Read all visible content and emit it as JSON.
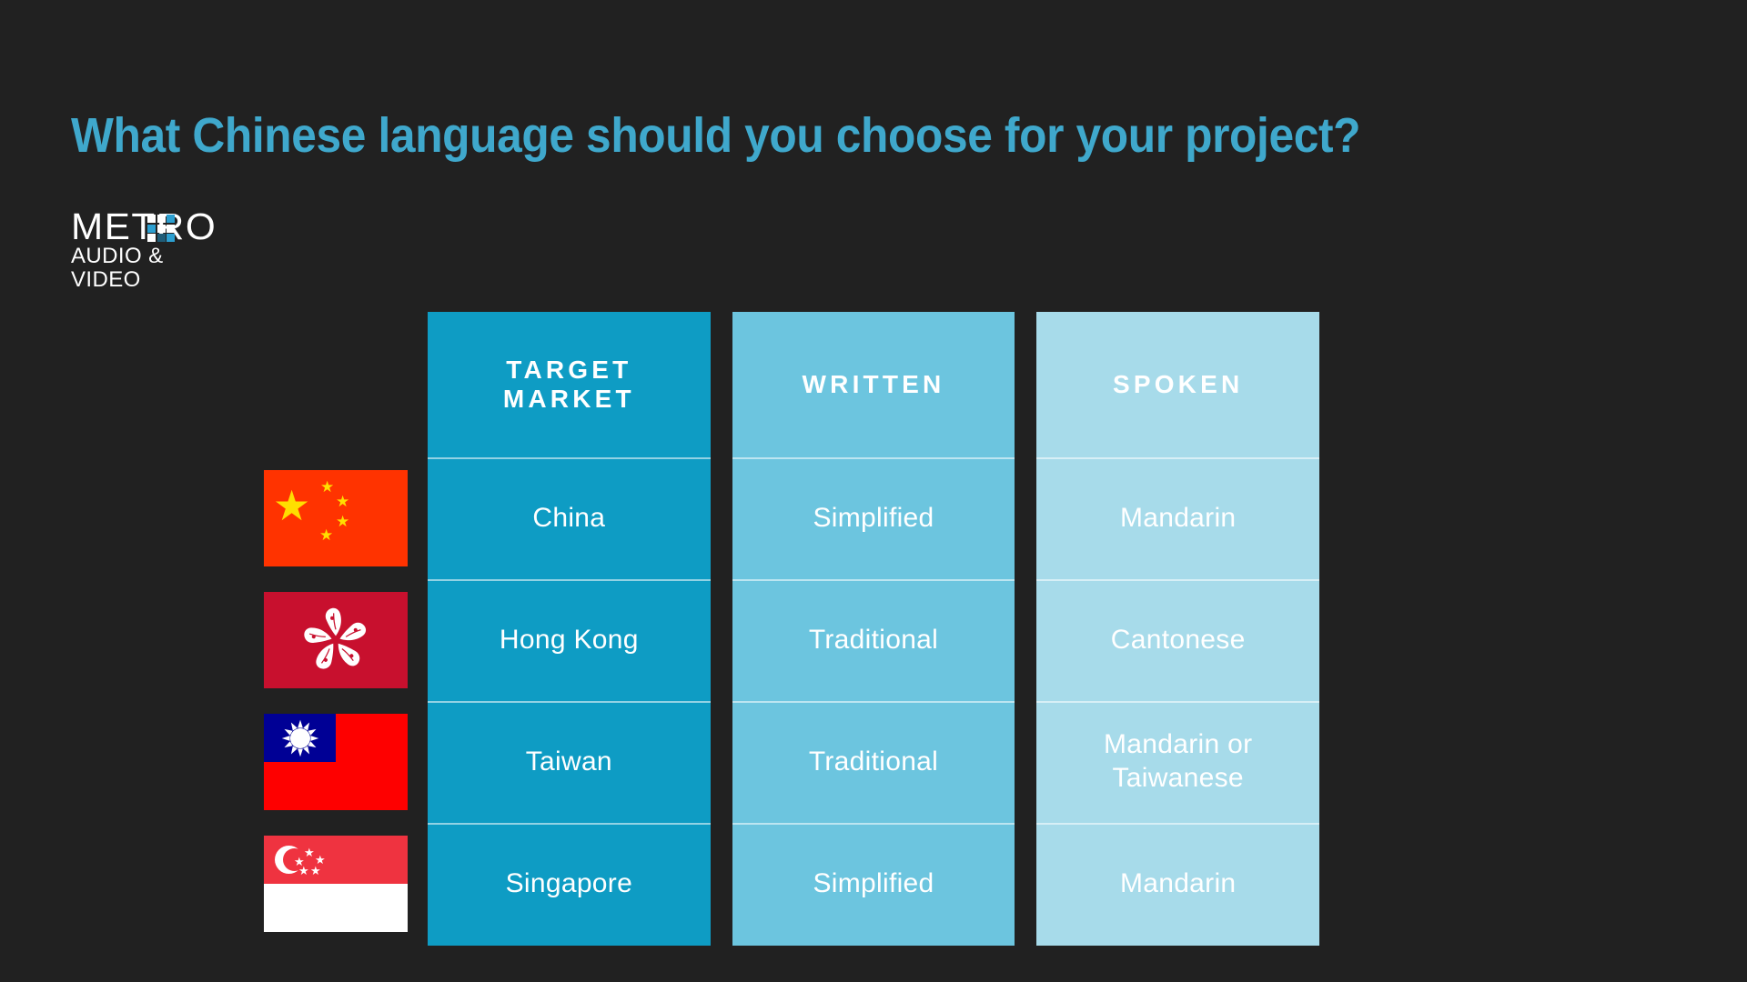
{
  "slide": {
    "background_color": "#212121",
    "title": "What Chinese language should you choose for your project?",
    "title_color": "#3FA8CC"
  },
  "logo": {
    "wordmark": "METRO",
    "tagline": "AUDIO & VIDEO",
    "accent_color": "#2C9FD0",
    "text_color": "#FFFFFF"
  },
  "table": {
    "columns": [
      {
        "key": "target_market",
        "header": "TARGET MARKET",
        "color": "#0E9CC4"
      },
      {
        "key": "written",
        "header": "WRITTEN",
        "color": "#6CC5DF"
      },
      {
        "key": "spoken",
        "header": "SPOKEN",
        "color": "#A7DBEA"
      }
    ],
    "rows": [
      {
        "flag": "china-flag",
        "flag_colors": {
          "field": "#FF3300",
          "star": "#FFDE00"
        },
        "target_market": "China",
        "written": "Simplified",
        "spoken": "Mandarin"
      },
      {
        "flag": "hong-kong-flag",
        "flag_colors": {
          "field": "#C8102E",
          "emblem": "#FFFFFF"
        },
        "target_market": "Hong Kong",
        "written": "Traditional",
        "spoken": "Cantonese"
      },
      {
        "flag": "taiwan-flag",
        "flag_colors": {
          "field": "#FE0000",
          "canton": "#000095",
          "sun": "#FFFFFF"
        },
        "target_market": "Taiwan",
        "written": "Traditional",
        "spoken": "Mandarin or Taiwanese"
      },
      {
        "flag": "singapore-flag",
        "flag_colors": {
          "top": "#EF3340",
          "bottom": "#FFFFFF",
          "emblem": "#FFFFFF"
        },
        "target_market": "Singapore",
        "written": "Simplified",
        "spoken": "Mandarin"
      }
    ]
  }
}
